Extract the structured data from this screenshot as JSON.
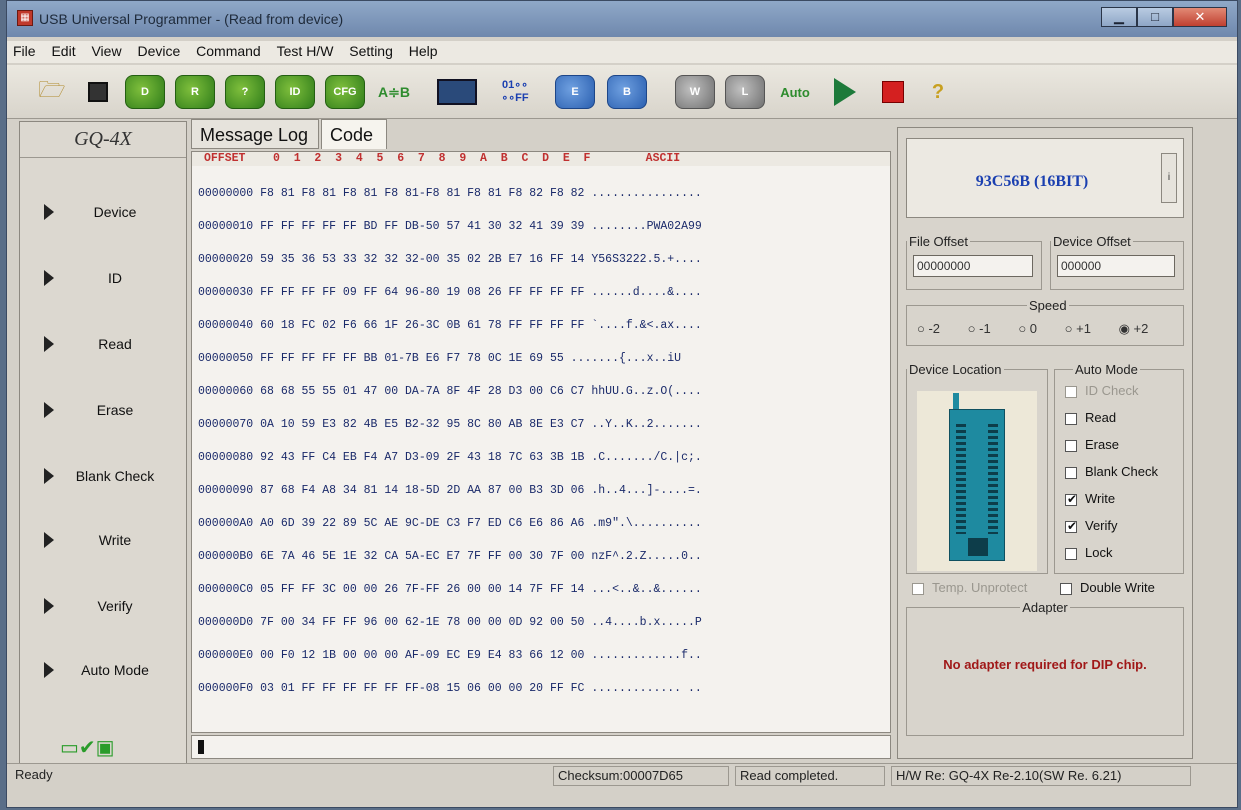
{
  "window": {
    "title": "USB Universal Programmer - (Read from device)",
    "icon": "app-chip-icon",
    "controls": [
      "minimize",
      "maximize",
      "close"
    ]
  },
  "menu": [
    "File",
    "Edit",
    "View",
    "Device",
    "Command",
    "Test H/W",
    "Setting",
    "Help"
  ],
  "toolbar": {
    "buttons": [
      {
        "name": "open-file-button",
        "icon": "folder-icon"
      },
      {
        "name": "save-button",
        "icon": "floppy-icon"
      },
      {
        "name": "select-device-button",
        "label": "D"
      },
      {
        "name": "read-button",
        "label": "R"
      },
      {
        "name": "verify-button",
        "label": "?"
      },
      {
        "name": "read-id-button",
        "label": "ID"
      },
      {
        "name": "config-button",
        "label": "CFG"
      },
      {
        "name": "compare-button",
        "label": "A≑B"
      },
      {
        "name": "hex-editor-button",
        "icon": "keyboard-icon"
      },
      {
        "name": "fill-button",
        "label": "01∘∘ ∘∘FF"
      },
      {
        "name": "erase-button",
        "label": "E"
      },
      {
        "name": "blank-check-button",
        "label": "B"
      },
      {
        "name": "write-button",
        "label": "W"
      },
      {
        "name": "lock-button",
        "label": "L"
      },
      {
        "name": "auto-button",
        "label": "Auto"
      },
      {
        "name": "run-button",
        "icon": "play-icon"
      },
      {
        "name": "stop-button",
        "icon": "stop-icon"
      },
      {
        "name": "help-button",
        "label": "?"
      }
    ]
  },
  "sidebar": {
    "title": "GQ-4X",
    "items": [
      "Device",
      "ID",
      "Read",
      "Erase",
      "Blank Check",
      "Write",
      "Verify",
      "Auto Mode"
    ]
  },
  "tabs": [
    "Message Log",
    "Code"
  ],
  "hex": {
    "header": "OFFSET    0  1  2  3  4  5  6  7  8  9  A  B  C  D  E  F        ASCII",
    "lines": [
      "00000000 F8 81 F8 81 F8 81 F8 81-F8 81 F8 81 F8 82 F8 82 ................",
      "00000010 FF FF FF FF FF BD FF DB-50 57 41 30 32 41 39 39 ........PWA02A99",
      "00000020 59 35 36 53 33 32 32 32-00 35 02 2B E7 16 FF 14 Y56S3222.5.+....",
      "00000030 FF FF FF FF 09 FF 64 96-80 19 08 26 FF FF FF FF ......d....&....",
      "00000040 60 18 FC 02 F6 66 1F 26-3C 0B 61 78 FF FF FF FF `....f.&<.ax....",
      "00000050 FF FF FF FF FF BB 01-7B E6 F7 78 0C 1E 69 55 .......{...x..iU",
      "00000060 68 68 55 55 01 47 00 DA-7A 8F 4F 28 D3 00 C6 C7 hhUU.G..z.O(....",
      "00000070 0A 10 59 E3 82 4B E5 B2-32 95 8C 80 AB 8E E3 C7 ..Y..K..2.......",
      "00000080 92 43 FF C4 EB F4 A7 D3-09 2F 43 18 7C 63 3B 1B .C......./C.|c;.",
      "00000090 87 68 F4 A8 34 81 14 18-5D 2D AA 87 00 B3 3D 06 .h..4...]-....=.",
      "000000A0 A0 6D 39 22 89 5C AE 9C-DE C3 F7 ED C6 E6 86 A6 .m9\".\\..........",
      "000000B0 6E 7A 46 5E 1E 32 CA 5A-EC E7 7F FF 00 30 7F 00 nzF^.2.Z.....0..",
      "000000C0 05 FF FF 3C 00 00 26 7F-FF 26 00 00 14 7F FF 14 ...<..&..&......",
      "000000D0 7F 00 34 FF FF 96 00 62-1E 78 00 00 0D 92 00 50 ..4....b.x.....P",
      "000000E0 00 F0 12 1B 00 00 00 AF-09 EC E9 E4 83 66 12 00 .............f..",
      "000000F0 03 01 FF FF FF FF FF FF-08 15 06 00 00 20 FF FC ............. .."
    ]
  },
  "right": {
    "device": "93C56B (16BIT)",
    "info_button": "i",
    "file_offset_label": "File Offset",
    "file_offset": "00000000",
    "device_offset_label": "Device Offset",
    "device_offset": "000000",
    "speed_label": "Speed",
    "speed_options": [
      "-2",
      "-1",
      "0",
      "+1",
      "+2"
    ],
    "speed_selected": "+2",
    "device_location_label": "Device Location",
    "auto_mode_label": "Auto Mode",
    "auto_items": [
      {
        "label": "ID Check",
        "checked": false,
        "disabled": true
      },
      {
        "label": "Read",
        "checked": false,
        "disabled": false
      },
      {
        "label": "Erase",
        "checked": false,
        "disabled": false
      },
      {
        "label": "Blank Check",
        "checked": false,
        "disabled": false
      },
      {
        "label": "Write",
        "checked": true,
        "disabled": false
      },
      {
        "label": "Verify",
        "checked": true,
        "disabled": false
      },
      {
        "label": "Lock",
        "checked": false,
        "disabled": false
      }
    ],
    "temp_unprotect": "Temp. Unprotect",
    "double_write": "Double Write",
    "adapter_label": "Adapter",
    "adapter_msg": "No adapter required for DIP chip."
  },
  "status": {
    "ready": "Ready",
    "checksum": "Checksum:00007D65",
    "message": "Read completed.",
    "hw": "H/W Re: GQ-4X Re-2.10(SW Re. 6.21)"
  }
}
